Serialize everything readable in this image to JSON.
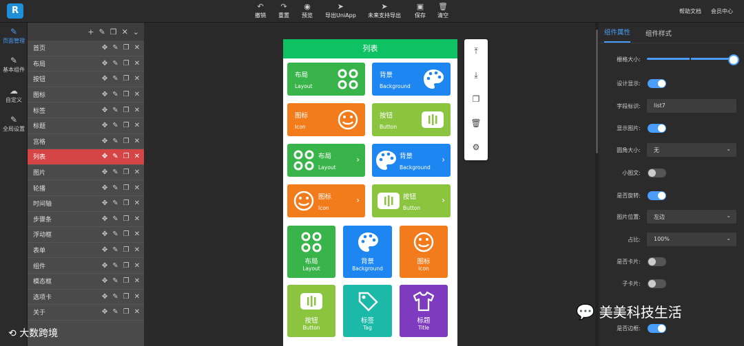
{
  "toolbar": {
    "undo": "撤销",
    "redo": "重置",
    "preview": "预览",
    "export_uniapp": "导出UniApp",
    "future": "未来支持导出",
    "save": "保存",
    "clear": "清空",
    "help": "帮助文档",
    "member": "会员中心"
  },
  "leftnav": {
    "pages": "页面管理",
    "basic": "基本组件",
    "custom": "自定义",
    "global": "全局设置"
  },
  "pages": [
    {
      "label": "首页"
    },
    {
      "label": "布局"
    },
    {
      "label": "按钮"
    },
    {
      "label": "图标"
    },
    {
      "label": "标签"
    },
    {
      "label": "标题"
    },
    {
      "label": "宫格"
    },
    {
      "label": "列表"
    },
    {
      "label": "图片"
    },
    {
      "label": "轮播"
    },
    {
      "label": "时间轴"
    },
    {
      "label": "步骤条"
    },
    {
      "label": "浮动框"
    },
    {
      "label": "表单"
    },
    {
      "label": "组件"
    },
    {
      "label": "模态框"
    },
    {
      "label": "选项卡"
    },
    {
      "label": "关于"
    }
  ],
  "active_page": "列表",
  "phone": {
    "title": "列表",
    "layout": "布局",
    "layout_en": "Layout",
    "background": "背景",
    "background_en": "Background",
    "icon": "图标",
    "icon_en": "Icon",
    "button": "按钮",
    "button_en": "Button",
    "tag": "标签",
    "tag_en": "Tag",
    "headline": "标题",
    "headline_en": "Title"
  },
  "colors": {
    "green": "#39b44a",
    "blue": "#1d86f0",
    "orange": "#f27b1b",
    "lime": "#8bc53f",
    "teal": "#1cb9a8",
    "purple": "#7f3bbf",
    "title_bar": "#0ec163",
    "active": "#d64545",
    "accent": "#4a9df8"
  },
  "right": {
    "tab_props": "组件属性",
    "tab_style": "组件样式",
    "grid_size": "栅格大小:",
    "design_show": "设计显示:",
    "field_id": "字段标识:",
    "field_value": "list7",
    "show_image": "显示图片:",
    "radius": "圆角大小:",
    "radius_value": "无",
    "small_img": "小图文:",
    "is_rotate": "是否旋转:",
    "img_pos": "图片位置:",
    "img_pos_value": "左边",
    "ratio": "占比:",
    "ratio_value": "100%",
    "is_card": "是否卡片:",
    "sub_card": "子卡片:",
    "is_border": "是否边框:"
  },
  "toggles": {
    "design_show": true,
    "show_image": true,
    "small_img": false,
    "is_rotate": true,
    "is_card": false,
    "sub_card": false,
    "is_border": true
  },
  "slider": {
    "grid_size": 1.0
  },
  "watermark": {
    "wechat": "美美科技生活",
    "brand": "大数跨境"
  },
  "icons": [
    "undo-icon",
    "redo-icon",
    "eye-icon",
    "send-icon",
    "save-icon",
    "trash-icon",
    "move-icon",
    "edit-icon",
    "copy-icon",
    "close-icon",
    "plus-icon",
    "layout-grid-icon",
    "palette-icon",
    "smile-icon",
    "button-icon",
    "tag-icon",
    "shirt-icon",
    "upload-icon",
    "download-icon",
    "gear-icon",
    "cloud-icon"
  ]
}
